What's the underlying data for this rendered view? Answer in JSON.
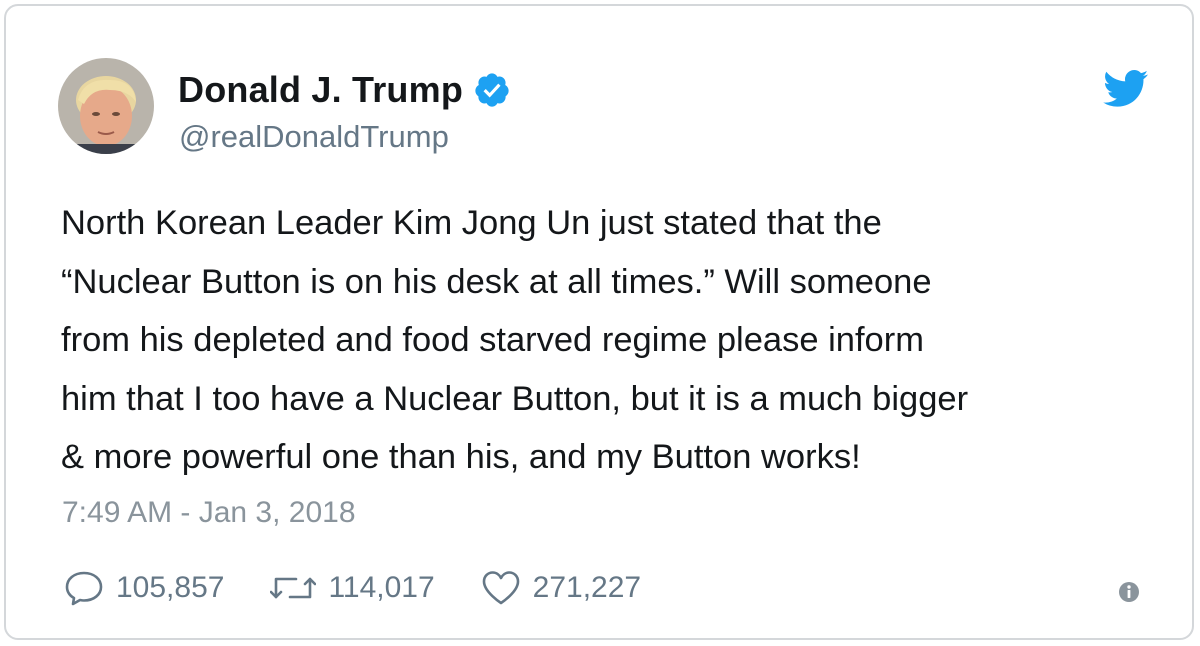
{
  "author": {
    "display_name": "Donald J. Trump",
    "handle": "@realDonaldTrump",
    "verified": true,
    "avatar_icon": "profile-photo"
  },
  "tweet": {
    "text": "North Korean Leader Kim Jong Un just stated that the\n“Nuclear Button is on his desk at all times.” Will someone\nfrom his depleted and food starved regime please inform\nhim that I too have a Nuclear Button, but it is a much bigger\n& more powerful one than his, and my Button works!",
    "timestamp": "7:49 AM - Jan 3, 2018"
  },
  "stats": {
    "replies": "105,857",
    "retweets": "114,017",
    "likes": "271,227"
  },
  "icons": {
    "brand": "twitter-bird-icon",
    "verified": "verified-badge-icon",
    "reply": "reply-icon",
    "retweet": "retweet-icon",
    "like": "heart-icon",
    "info": "info-icon"
  },
  "colors": {
    "brand_blue": "#1da1f2",
    "text": "#14171a",
    "muted": "#657786",
    "border": "#d4d7da"
  }
}
